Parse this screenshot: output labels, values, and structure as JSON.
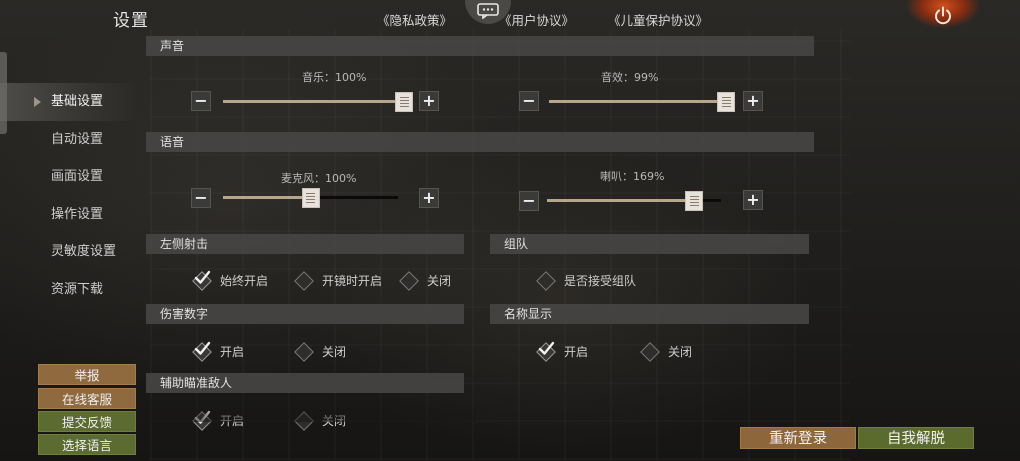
{
  "header": {
    "title": "设置",
    "links": {
      "privacy": "《隐私政策》",
      "user_agreement": "《用户协议》",
      "child_protection": "《儿童保护协议》"
    },
    "icons": {
      "chat": "chat-bubble-icon",
      "power": "power-icon"
    }
  },
  "sidebar": {
    "items": [
      {
        "label": "基础设置",
        "active": true
      },
      {
        "label": "自动设置",
        "active": false
      },
      {
        "label": "画面设置",
        "active": false
      },
      {
        "label": "操作设置",
        "active": false
      },
      {
        "label": "灵敏度设置",
        "active": false
      },
      {
        "label": "资源下载",
        "active": false
      }
    ],
    "buttons": {
      "report": "举报",
      "online_service": "在线客服",
      "feedback": "提交反馈",
      "language": "选择语言"
    }
  },
  "sections": {
    "sound": {
      "title": "声音",
      "music": {
        "label": "音乐：100%",
        "value": 100,
        "max": 100
      },
      "effects": {
        "label": "音效：99%",
        "value": 99,
        "max": 100
      }
    },
    "voice": {
      "title": "语音",
      "microphone": {
        "label": "麦克风：100%",
        "value": 100,
        "max": 200
      },
      "speaker": {
        "label": "喇叭：169%",
        "value": 169,
        "max": 200
      }
    },
    "left_fire": {
      "title": "左侧射击",
      "options": [
        {
          "label": "始终开启",
          "checked": true
        },
        {
          "label": "开镜时开启",
          "checked": false
        },
        {
          "label": "关闭",
          "checked": false
        }
      ]
    },
    "team": {
      "title": "组队",
      "options": [
        {
          "label": "是否接受组队",
          "checked": false
        }
      ]
    },
    "damage_numbers": {
      "title": "伤害数字",
      "options": [
        {
          "label": "开启",
          "checked": true
        },
        {
          "label": "关闭",
          "checked": false
        }
      ]
    },
    "name_display": {
      "title": "名称显示",
      "options": [
        {
          "label": "开启",
          "checked": true
        },
        {
          "label": "关闭",
          "checked": false
        }
      ]
    },
    "aim_assist": {
      "title": "辅助瞄准敌人",
      "options": [
        {
          "label": "开启",
          "checked": true
        },
        {
          "label": "关闭",
          "checked": false
        }
      ]
    }
  },
  "footer": {
    "relogin": "重新登录",
    "unstuck": "自我解脱"
  },
  "colors": {
    "track_fill": "#b8a68c",
    "orange_button": "#8e663c",
    "green_button": "#5b6b2d",
    "power_glow": "#d0501c"
  }
}
